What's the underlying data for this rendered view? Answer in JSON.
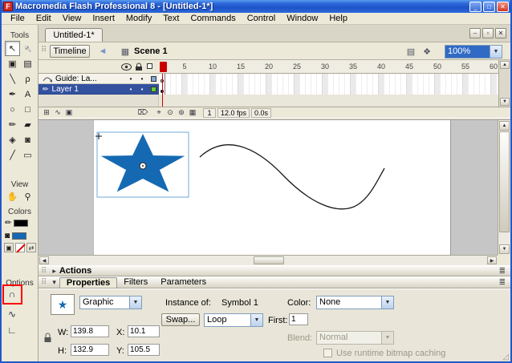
{
  "window": {
    "title": "Macromedia Flash Professional 8 - [Untitled-1*]",
    "app_icon_letter": "F",
    "controls": {
      "minimize": "_",
      "maximize": "□",
      "close": "✕"
    }
  },
  "menu": {
    "items": [
      "File",
      "Edit",
      "View",
      "Insert",
      "Modify",
      "Text",
      "Commands",
      "Control",
      "Window",
      "Help"
    ]
  },
  "sidebar": {
    "sections": {
      "tools": "Tools",
      "view": "View",
      "colors": "Colors",
      "options": "Options"
    },
    "tools": [
      {
        "id": "selection",
        "glyph": "↖"
      },
      {
        "id": "subselection",
        "glyph": "↖"
      },
      {
        "id": "free-transform",
        "glyph": "▣"
      },
      {
        "id": "gradient-transform",
        "glyph": "▤"
      },
      {
        "id": "line",
        "glyph": "╲"
      },
      {
        "id": "lasso",
        "glyph": "ρ"
      },
      {
        "id": "pen",
        "glyph": "✒"
      },
      {
        "id": "text",
        "glyph": "A"
      },
      {
        "id": "oval",
        "glyph": "○"
      },
      {
        "id": "rectangle",
        "glyph": "□"
      },
      {
        "id": "pencil",
        "glyph": "✏"
      },
      {
        "id": "brush",
        "glyph": "▰"
      },
      {
        "id": "ink-bottle",
        "glyph": "◈"
      },
      {
        "id": "paint-bucket",
        "glyph": "◙"
      },
      {
        "id": "eyedropper",
        "glyph": "╱"
      },
      {
        "id": "eraser",
        "glyph": "▭"
      }
    ],
    "view_tools": [
      {
        "id": "hand",
        "glyph": "✋"
      },
      {
        "id": "zoom",
        "glyph": "⚲"
      }
    ],
    "color_tools": {
      "stroke_glyph": "✏",
      "fill_glyph": "◙",
      "default_glyph": "▣",
      "none_glyph": "",
      "swap_glyph": "⇄"
    },
    "option_tools": [
      {
        "id": "snap-to-objects",
        "glyph": "∩"
      },
      {
        "id": "smooth",
        "glyph": "∿"
      },
      {
        "id": "straighten",
        "glyph": "∟"
      }
    ]
  },
  "document": {
    "tab": "Untitled-1*",
    "window_controls": {
      "minimize": "‒",
      "restore": "▫",
      "close": "✕"
    }
  },
  "timeline_bar": {
    "timeline_button": "Timeline",
    "back_glyph": "◄",
    "scene_icon_glyph": "▦",
    "scene_label": "Scene 1",
    "edit_scene_glyph": "▤",
    "edit_symbol_glyph": "❖",
    "zoom_value": "100%"
  },
  "timeline": {
    "layers": [
      {
        "name": "Guide: La...",
        "selected": false
      },
      {
        "name": "Layer 1",
        "selected": true
      }
    ],
    "pencil_glyph": "✏",
    "dot_glyph": "•",
    "ruler": [
      "5",
      "10",
      "15",
      "20",
      "25",
      "30",
      "35",
      "40",
      "45",
      "50",
      "55",
      "60"
    ],
    "buttons": {
      "insert_layer": "⊞",
      "add_motion_guide": "∿",
      "insert_folder": "▣",
      "delete_layer": "⌦",
      "center_frame": "⌖",
      "onion_skin": "⊙",
      "onion_outlines": "⊚",
      "edit_multiple_frames": "▦"
    },
    "status": {
      "frame": "1",
      "fps": "12.0 fps",
      "time": "0.0s"
    }
  },
  "panels": {
    "actions": {
      "arrow_glyph": "▸",
      "label": "Actions",
      "menu_glyph": "≣"
    },
    "properties": {
      "arrow_glyph": "▾",
      "menu_glyph": "≣",
      "tabs": [
        "Properties",
        "Filters",
        "Parameters"
      ],
      "symbol_icon_glyph": "★",
      "behavior": "Graphic",
      "instance_label": "Instance of:",
      "instance_name": "Symbol 1",
      "swap_button": "Swap...",
      "loop": "Loop",
      "first_label": "First:",
      "first_value": "1",
      "color_label": "Color:",
      "color_value": "None",
      "blend_label": "Blend:",
      "blend_value": "Normal",
      "bitmap_caching_label": "Use runtime bitmap caching",
      "lock_tooltip_glyph": "",
      "w_label": "W:",
      "w_value": "139.8",
      "h_label": "H:",
      "h_value": "132.9",
      "x_label": "X:",
      "x_value": "10.1",
      "y_label": "Y:",
      "y_value": "105.5",
      "resize_grip_glyph": "◿"
    }
  },
  "colors": {
    "star_fill": "#1569B3",
    "annotation_red": "#FF0000",
    "selected_layer_blue": "#33519F"
  }
}
